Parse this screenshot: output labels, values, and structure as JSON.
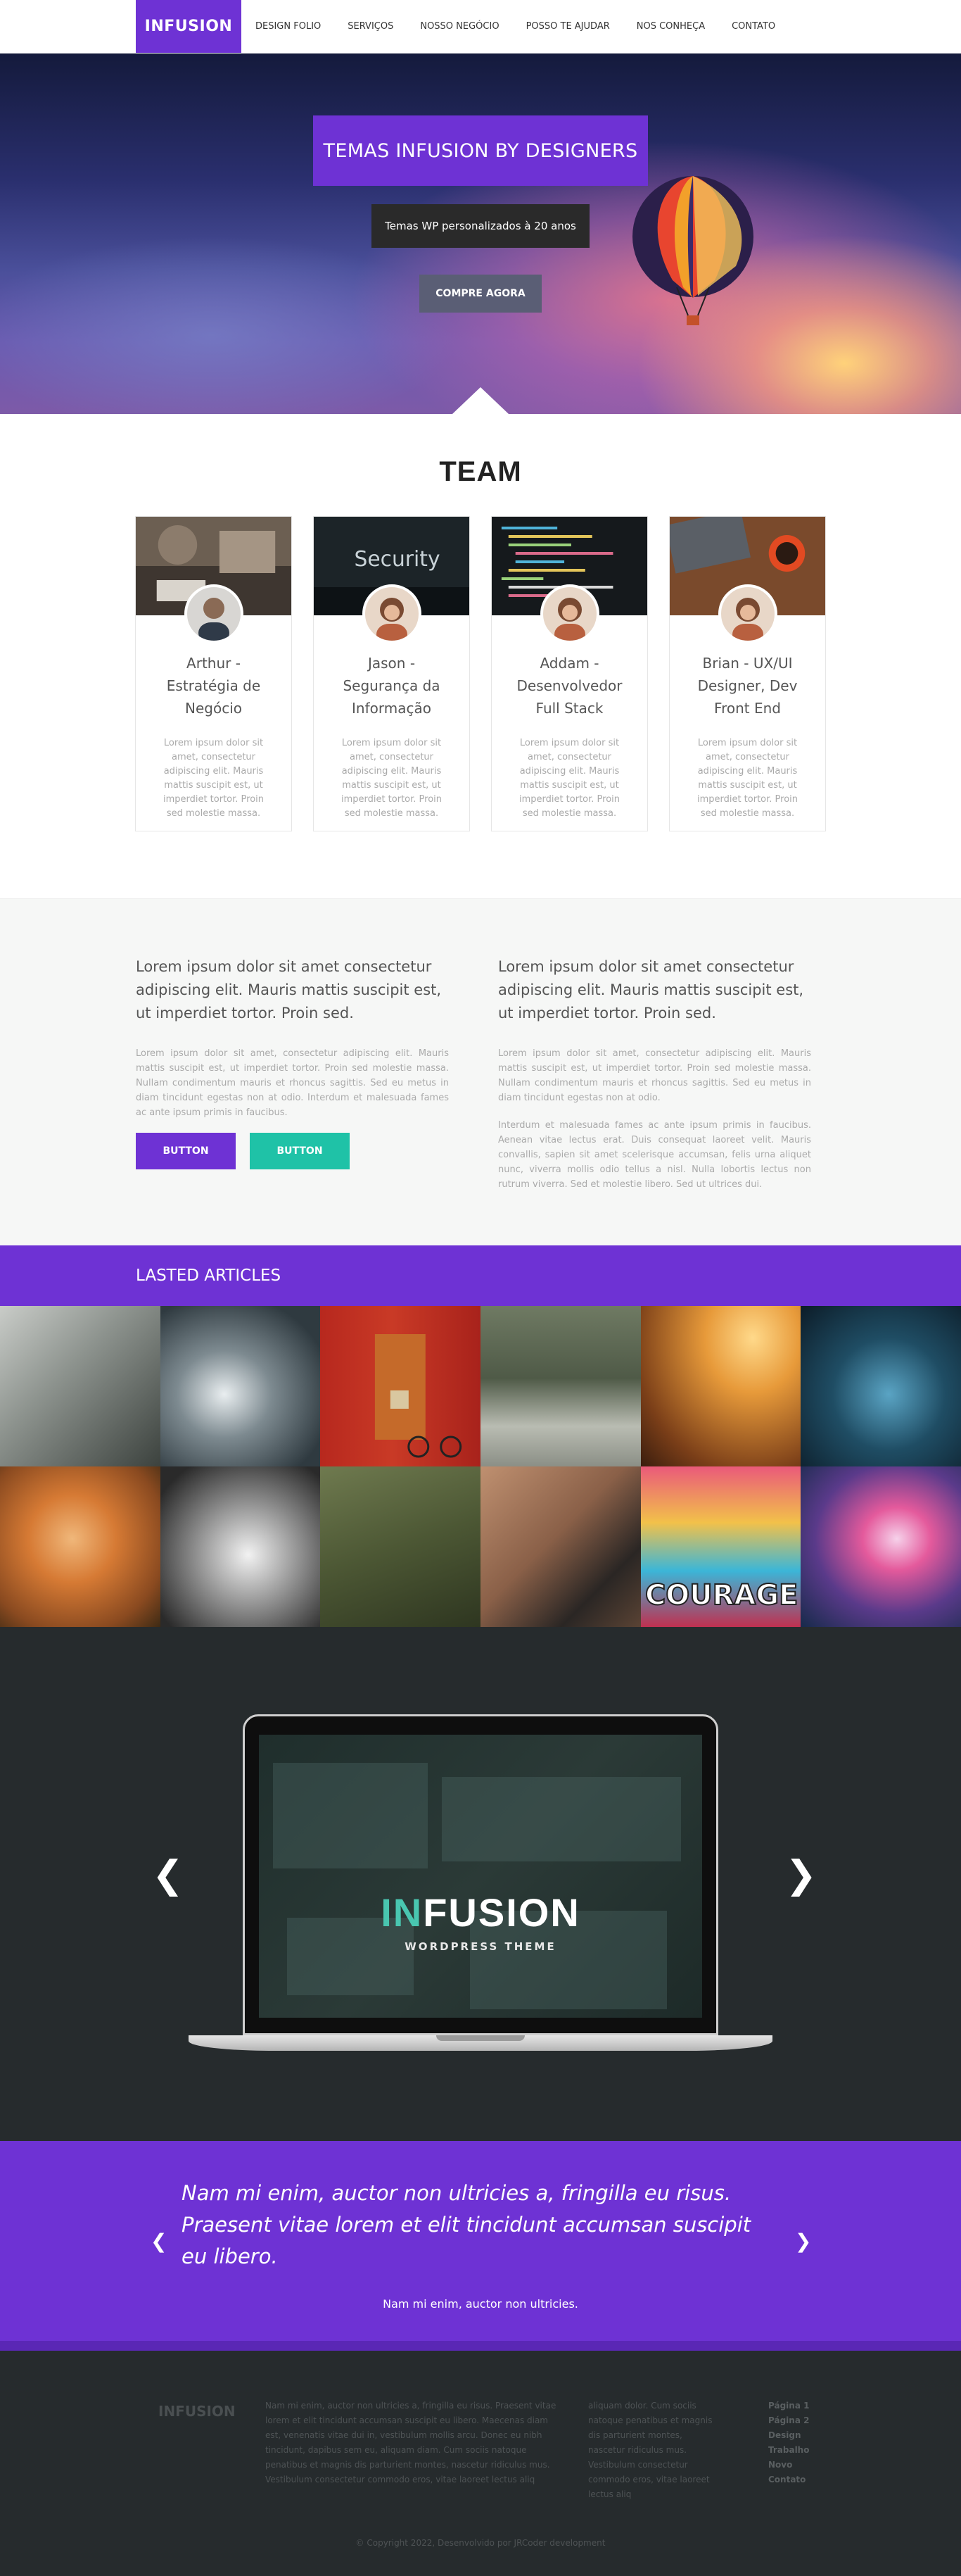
{
  "nav": {
    "logo": "INFUSION",
    "items": [
      "DESIGN FOLIO",
      "SERVIÇOS",
      "NOSSO NEGÓCIO",
      "POSSO TE AJUDAR",
      "NOS CONHEÇA",
      "CONTATO"
    ]
  },
  "hero": {
    "title": "TEMAS INFUSION BY DESIGNERS",
    "subtitle": "Temas WP personalizados à 20 anos",
    "cta": "COMPRE AGORA"
  },
  "team": {
    "title": "TEAM",
    "members": [
      {
        "name": "Arthur - Estratégia de Negócio",
        "text": "Lorem ipsum dolor sit amet, consectetur adipiscing elit. Mauris mattis suscipit est, ut imperdiet tortor. Proin sed molestie massa."
      },
      {
        "name": "Jason - Segurança da Informação",
        "text": "Lorem ipsum dolor sit amet, consectetur adipiscing elit. Mauris mattis suscipit est, ut imperdiet tortor. Proin sed molestie massa."
      },
      {
        "name": "Addam - Desenvolvedor Full Stack",
        "text": "Lorem ipsum dolor sit amet, consectetur adipiscing elit. Mauris mattis suscipit est, ut imperdiet tortor. Proin sed molestie massa."
      },
      {
        "name": "Brian - UX/UI Designer, Dev Front End",
        "text": "Lorem ipsum dolor sit amet, consectetur adipiscing elit. Mauris mattis suscipit est, ut imperdiet tortor. Proin sed molestie massa."
      }
    ],
    "security_word": "Security"
  },
  "lorem": {
    "left": {
      "lead": "Lorem ipsum dolor sit amet consectetur adipiscing elit. Mauris mattis suscipit est, ut imperdiet tortor. Proin sed.",
      "body": "Lorem ipsum dolor sit amet, consectetur adipiscing elit. Mauris mattis suscipit est, ut imperdiet tortor. Proin sed molestie massa. Nullam condimentum mauris et rhoncus sagittis. Sed eu metus in diam tincidunt egestas non at odio. Interdum et malesuada fames ac ante ipsum primis in faucibus.",
      "button1": "BUTTON",
      "button2": "BUTTON"
    },
    "right": {
      "lead": "Lorem ipsum dolor sit amet consectetur adipiscing elit. Mauris mattis suscipit est, ut imperdiet tortor. Proin sed.",
      "body": "Lorem ipsum dolor sit amet, consectetur adipiscing elit. Mauris mattis suscipit est, ut imperdiet tortor. Proin sed molestie massa. Nullam condimentum mauris et rhoncus sagittis. Sed eu metus in diam tincidunt egestas non at odio.",
      "body2": "Interdum et malesuada fames ac ante ipsum primis in faucibus. Aenean vitae lectus erat. Duis consequat laoreet velit. Mauris convallis, sapien sit amet scelerisque accumsan, felis urna aliquet nunc, viverra mollis odio tellus a nisl. Nulla lobortis lectus non rutrum viverra. Sed et molestie libero. Sed ut ultrices dui."
    }
  },
  "articles": {
    "title": "LASTED ARTICLES",
    "courage_word": "COURAGE"
  },
  "showcase": {
    "title_accent": "IN",
    "title_rest": "FUSION",
    "subtitle": "WORDPRESS THEME",
    "prev": "❮",
    "next": "❯"
  },
  "testimonial": {
    "quote": "Nam mi enim, auctor non ultricies a, fringilla eu risus. Praesent vitae lorem et elit tincidunt accumsan suscipit eu libero.",
    "author": "Nam mi enim, auctor non ultricies.",
    "prev": "❮",
    "next": "❯"
  },
  "footer": {
    "logo": "INFUSION",
    "col1": "Nam mi enim, auctor non ultricies a, fringilla eu risus. Praesent vitae lorem et elit tincidunt accumsan suscipit eu libero. Maecenas diam est, venenatis vitae dui in, vestibulum mollis arcu. Donec eu nibh tincidunt, dapibus sem eu, aliquam diam. Cum sociis natoque penatibus et magnis dis parturient montes, nascetur ridiculus mus. Vestibulum consectetur commodo eros, vitae laoreet lectus aliq",
    "col2": "aliquam dolor. Cum sociis natoque penatibus et magnis dis parturient montes, nascetur ridiculus mus. Vestibulum consectetur commodo eros, vitae laoreet lectus aliq",
    "links": [
      "Página 1",
      "Página 2",
      "Design",
      "Trabalho",
      "Novo",
      "Contato"
    ],
    "copyright": "© Copyright 2022, Desenvolvido por JRCoder development"
  },
  "colors": {
    "brand_purple": "#6e32d4",
    "teal": "#1fc2a7",
    "dark": "#262b2d"
  }
}
